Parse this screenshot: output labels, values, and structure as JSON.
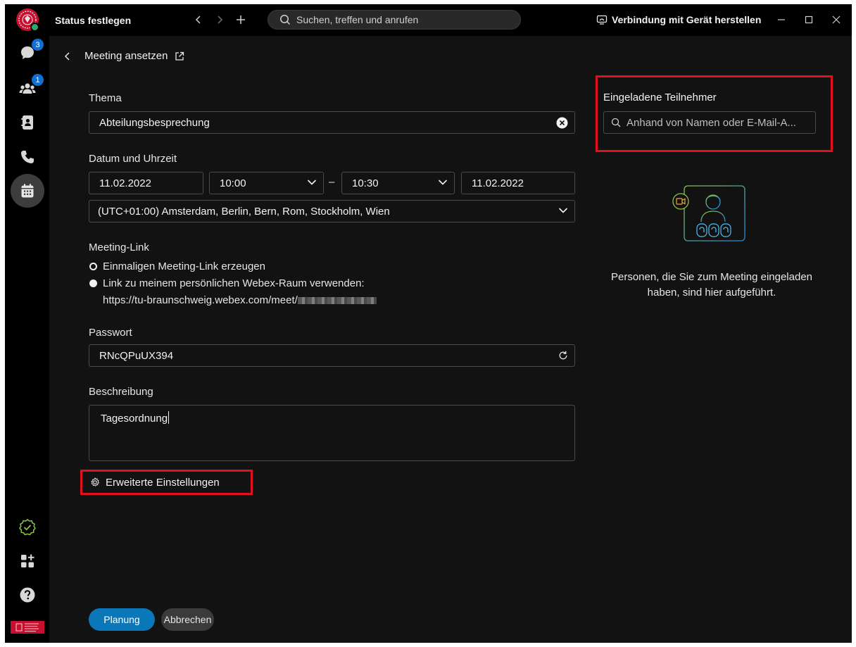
{
  "titlebar": {
    "status_label": "Status festlegen",
    "search_placeholder": "Suchen, treffen und anrufen",
    "connect_label": "Verbindung mit Gerät herstellen"
  },
  "sidebar": {
    "messages_badge": "3",
    "teams_badge": "1"
  },
  "page": {
    "title": "Meeting ansetzen"
  },
  "form": {
    "topic_label": "Thema",
    "topic_value": "Abteilungsbesprechung",
    "datetime_label": "Datum und Uhrzeit",
    "start_date": "11.02.2022",
    "start_time": "10:00",
    "dash": "–",
    "end_time": "10:30",
    "end_date": "11.02.2022",
    "timezone": "(UTC+01:00) Amsterdam, Berlin, Bern, Rom, Stockholm, Wien",
    "link_label": "Meeting-Link",
    "link_option1": "Einmaligen Meeting-Link erzeugen",
    "link_option2": "Link zu meinem persönlichen Webex-Raum verwenden:",
    "link_url": "https://tu-braunschweig.webex.com/meet/",
    "password_label": "Passwort",
    "password_value": "RNcQPuUX394",
    "description_label": "Beschreibung",
    "description_value": "Tagesordnung",
    "advanced_label": "Erweiterte Einstellungen",
    "schedule_button": "Planung",
    "cancel_button": "Abbrechen"
  },
  "invite": {
    "title": "Eingeladene Teilnehmer",
    "search_placeholder": "Anhand von Namen oder E-Mail-A...",
    "empty_text": "Personen, die Sie zum Meeting eingeladen haben, sind hier aufgeführt."
  },
  "colors": {
    "accent": "#0a78b8",
    "highlight": "#e0101c",
    "badge": "#0f6fd8",
    "presence": "#2ea86b"
  }
}
